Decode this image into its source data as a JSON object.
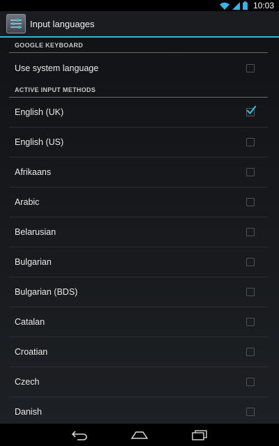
{
  "status_bar": {
    "time": "10:03",
    "icons": [
      "wifi-icon",
      "signal-icon",
      "battery-icon"
    ],
    "accent": "#33b5e5"
  },
  "action_bar": {
    "title": "Input languages",
    "icon": "settings-sliders-icon"
  },
  "sections": [
    {
      "header": "GOOGLE KEYBOARD",
      "items": [
        {
          "label": "Use system language",
          "checked": false
        }
      ]
    },
    {
      "header": "ACTIVE INPUT METHODS",
      "items": [
        {
          "label": "English (UK)",
          "checked": true
        },
        {
          "label": "English (US)",
          "checked": false
        },
        {
          "label": "Afrikaans",
          "checked": false
        },
        {
          "label": "Arabic",
          "checked": false
        },
        {
          "label": "Belarusian",
          "checked": false
        },
        {
          "label": "Bulgarian",
          "checked": false
        },
        {
          "label": "Bulgarian (BDS)",
          "checked": false
        },
        {
          "label": "Catalan",
          "checked": false
        },
        {
          "label": "Croatian",
          "checked": false
        },
        {
          "label": "Czech",
          "checked": false
        },
        {
          "label": "Danish",
          "checked": false
        }
      ]
    }
  ],
  "nav_bar": {
    "buttons": [
      "back-icon",
      "home-icon",
      "recent-apps-icon"
    ]
  }
}
